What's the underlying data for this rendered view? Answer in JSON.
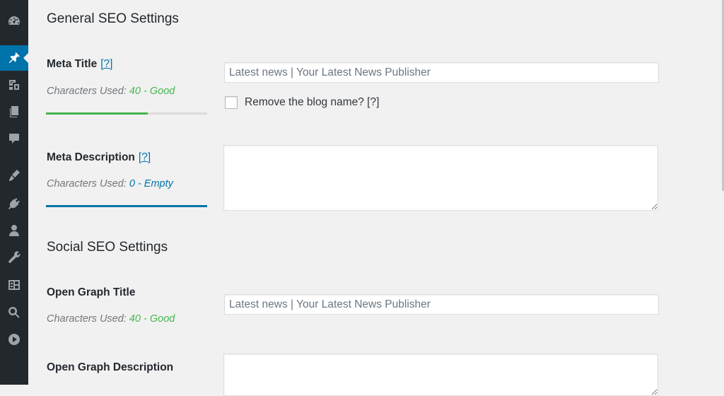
{
  "sidebar": {
    "items": [
      {
        "icon": "dashboard-icon",
        "active": false
      },
      {
        "icon": "pin-icon",
        "active": true
      },
      {
        "icon": "media-icon",
        "active": false
      },
      {
        "icon": "pages-icon",
        "active": false
      },
      {
        "icon": "comments-icon",
        "active": false
      },
      {
        "icon": "appearance-icon",
        "active": false
      },
      {
        "icon": "plugins-icon",
        "active": false
      },
      {
        "icon": "users-icon",
        "active": false
      },
      {
        "icon": "tools-icon",
        "active": false
      },
      {
        "icon": "settings-icon",
        "active": false
      },
      {
        "icon": "search-icon",
        "active": false
      },
      {
        "icon": "play-icon",
        "active": false
      }
    ]
  },
  "general": {
    "title": "General SEO Settings",
    "meta_title": {
      "label": "Meta Title",
      "help": "[?]",
      "chars_prefix": "Characters Used:",
      "chars_value": "40 - Good",
      "progress": 0.63,
      "color": "#46b450",
      "placeholder": "Latest news | Your Latest News Publisher",
      "value": ""
    },
    "remove_blog_name": {
      "label": "Remove the blog name? [?]",
      "checked": false
    },
    "meta_description": {
      "label": "Meta Description",
      "help": "[?]",
      "chars_prefix": "Characters Used:",
      "chars_value": "0 - Empty",
      "progress": 1.0,
      "color": "#0073aa",
      "value": ""
    }
  },
  "social": {
    "title": "Social SEO Settings",
    "og_title": {
      "label": "Open Graph Title",
      "chars_prefix": "Characters Used:",
      "chars_value": "40 - Good",
      "placeholder": "Latest news | Your Latest News Publisher",
      "value": ""
    },
    "og_description": {
      "label": "Open Graph Description",
      "value": ""
    }
  },
  "colors": {
    "sidebar_bg": "#23282d",
    "accent": "#0073aa",
    "good": "#46b450"
  }
}
